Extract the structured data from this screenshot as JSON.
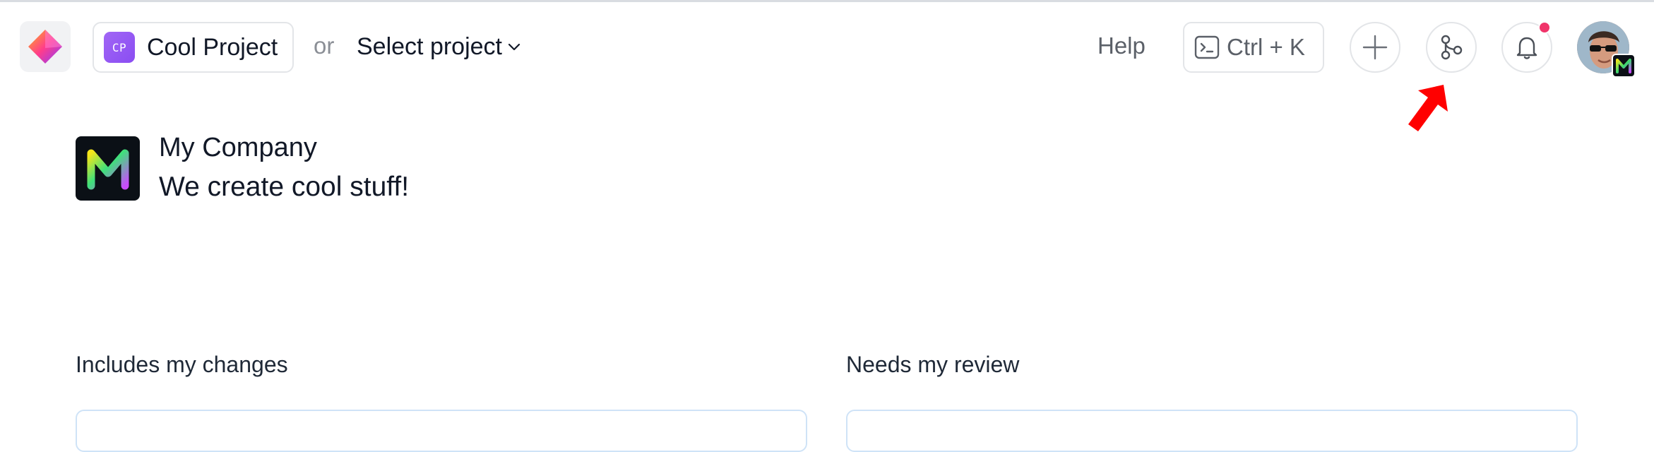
{
  "header": {
    "app_logo_icon": "app-logo-icon",
    "current_project": {
      "badge": "CP",
      "name": "Cool Project",
      "badge_color": "#9b5cf5"
    },
    "or_label": "or",
    "select_project_label": "Select project",
    "help_label": "Help",
    "command_palette": {
      "icon": "terminal-icon",
      "shortcut": "Ctrl + K"
    },
    "icons": [
      "plus-icon",
      "merge-request-icon",
      "bell-icon"
    ],
    "notification_dot_color": "#f0346a",
    "avatar_badge_icon": "company-logo-icon"
  },
  "annotation": {
    "icon": "red-arrow-icon",
    "color": "#ff0000"
  },
  "company": {
    "name": "My Company",
    "tagline": "We create cool stuff!"
  },
  "sections": {
    "left_title": "Includes my changes",
    "right_title": "Needs my review"
  }
}
